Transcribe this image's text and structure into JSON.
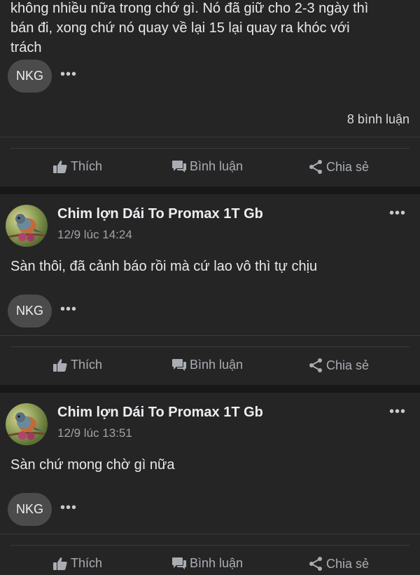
{
  "posts": [
    {
      "text_lines": [
        "không nhiều nữa trong chớ gì. Nó đã giữ cho 2-3 ngày thì",
        "bán đi, xong chứ nó quay về lại 15 lại quay ra khóc với",
        "trách"
      ],
      "chip_label": "NKG",
      "comment_count": "8 bình luận",
      "actions": {
        "like": "Thích",
        "comment": "Bình luận",
        "share": "Chia sẻ"
      }
    },
    {
      "author": "Chim lợn Dái To Promax 1T Gb",
      "time": "12/9 lúc 14:24",
      "text": "Sàn thôi, đã cảnh báo rồi mà cứ lao vô thì tự chịu",
      "chip_label": "NKG",
      "actions": {
        "like": "Thích",
        "comment": "Bình luận",
        "share": "Chia sẻ"
      }
    },
    {
      "author": "Chim lợn Dái To Promax 1T Gb",
      "time": "12/9 lúc 13:51",
      "text": "Sàn chứ mong chờ gì nữa",
      "chip_label": "NKG",
      "actions": {
        "like": "Thích",
        "comment": "Bình luận",
        "share": "Chia sẻ"
      }
    }
  ],
  "icons": {
    "more": "more-dots-icon",
    "like": "thumbs-up-icon",
    "comment": "comment-bubble-icon",
    "share": "share-icon",
    "avatar": "bird-avatar"
  },
  "colors": {
    "background": "#181818",
    "card": "#252525",
    "chip": "#4b4b4b",
    "secondary_text": "#9ea2a8"
  }
}
